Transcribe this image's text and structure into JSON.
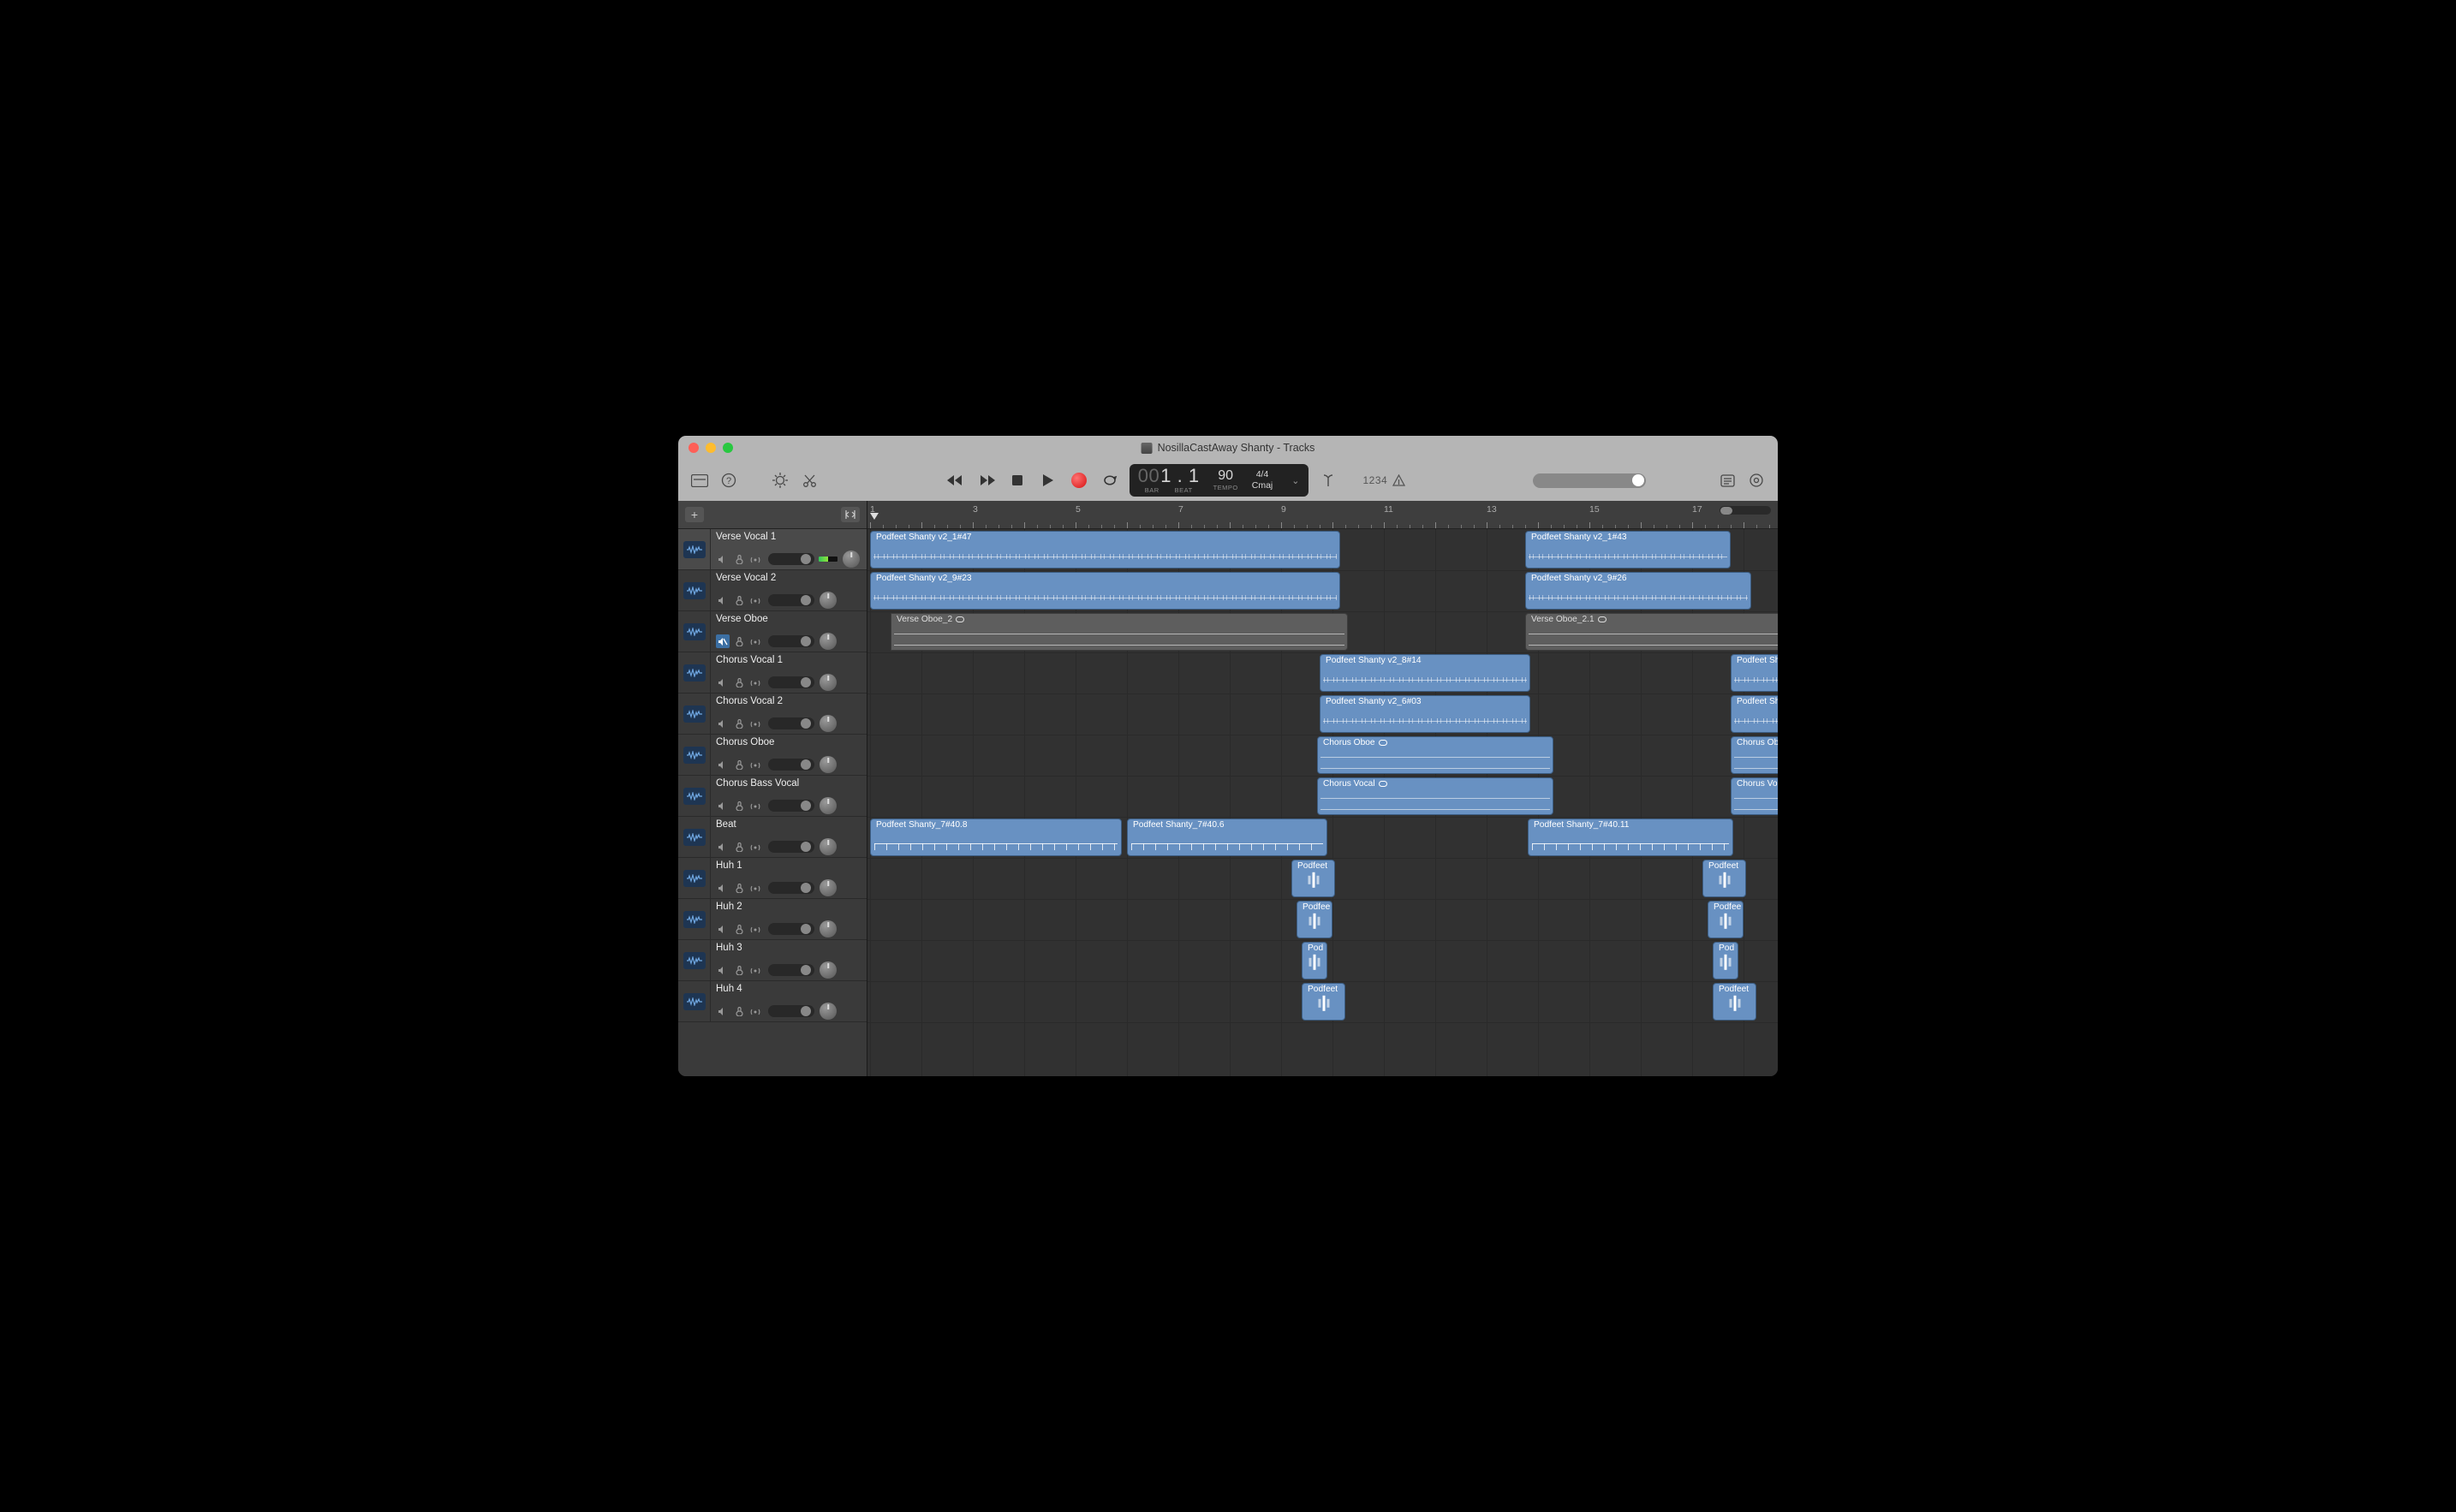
{
  "title": "NosillaCastAway Shanty - Tracks",
  "lcd": {
    "bar": "00",
    "beat": "1 . 1",
    "barLabel": "BAR",
    "beatLabel": "BEAT",
    "tempo": "90",
    "tempoLabel": "TEMPO",
    "sig": "4/4",
    "key": "Cmaj"
  },
  "countIn": "1234",
  "ruler": {
    "barWidth": 60,
    "startBar": 1,
    "numberedBars": [
      1,
      3,
      5,
      7,
      9,
      11,
      13,
      15,
      17
    ]
  },
  "tracks": [
    {
      "name": "Verse Vocal 1",
      "muted": false,
      "selected": true,
      "meter": 0.5,
      "volPos": 38
    },
    {
      "name": "Verse Vocal 2",
      "muted": false,
      "selected": false,
      "meter": 0,
      "volPos": 38
    },
    {
      "name": "Verse Oboe",
      "muted": true,
      "selected": false,
      "meter": 0,
      "volPos": 38
    },
    {
      "name": "Chorus Vocal 1",
      "muted": false,
      "selected": false,
      "meter": 0,
      "volPos": 38
    },
    {
      "name": "Chorus Vocal 2",
      "muted": false,
      "selected": false,
      "meter": 0,
      "volPos": 38
    },
    {
      "name": "Chorus Oboe",
      "muted": false,
      "selected": false,
      "meter": 0,
      "volPos": 38
    },
    {
      "name": "Chorus Bass Vocal",
      "muted": false,
      "selected": false,
      "meter": 0,
      "volPos": 38
    },
    {
      "name": "Beat",
      "muted": false,
      "selected": false,
      "meter": 0,
      "volPos": 38
    },
    {
      "name": "Huh 1",
      "muted": false,
      "selected": false,
      "meter": 0,
      "volPos": 38
    },
    {
      "name": "Huh 2",
      "muted": false,
      "selected": false,
      "meter": 0,
      "volPos": 38
    },
    {
      "name": "Huh 3",
      "muted": false,
      "selected": false,
      "meter": 0,
      "volPos": 38
    },
    {
      "name": "Huh 4",
      "muted": false,
      "selected": false,
      "meter": 0,
      "volPos": 38
    }
  ],
  "regions": [
    {
      "track": 0,
      "startBar": 1,
      "lenBars": 9.15,
      "label": "Podfeet Shanty v2_1#47",
      "style": "wave"
    },
    {
      "track": 0,
      "startBar": 13.75,
      "lenBars": 4.0,
      "label": "Podfeet Shanty v2_1#43",
      "style": "wave"
    },
    {
      "track": 1,
      "startBar": 1,
      "lenBars": 9.15,
      "label": "Podfeet Shanty v2_9#23",
      "style": "wave"
    },
    {
      "track": 1,
      "startBar": 13.75,
      "lenBars": 4.4,
      "label": "Podfeet Shanty v2_9#26",
      "style": "wave"
    },
    {
      "track": 2,
      "startBar": 1.4,
      "lenBars": 8.9,
      "label": "Verse Oboe_2",
      "loop": true,
      "style": "line",
      "grey": true,
      "leftInset": true
    },
    {
      "track": 2,
      "startBar": 13.75,
      "lenBars": 5.0,
      "label": "Verse Oboe_2.1",
      "loop": true,
      "style": "line",
      "grey": true
    },
    {
      "track": 3,
      "startBar": 9.75,
      "lenBars": 4.1,
      "label": "Podfeet Shanty v2_8#14",
      "style": "wave"
    },
    {
      "track": 3,
      "startBar": 17.75,
      "lenBars": 2.0,
      "label": "Podfeet Sh",
      "style": "wave"
    },
    {
      "track": 4,
      "startBar": 9.75,
      "lenBars": 4.1,
      "label": "Podfeet Shanty v2_6#03",
      "style": "wave"
    },
    {
      "track": 4,
      "startBar": 17.75,
      "lenBars": 2.0,
      "label": "Podfeet Sh",
      "style": "wave"
    },
    {
      "track": 5,
      "startBar": 9.7,
      "lenBars": 4.6,
      "label": "Chorus Oboe",
      "loop": true,
      "style": "line"
    },
    {
      "track": 5,
      "startBar": 17.75,
      "lenBars": 2.0,
      "label": "Chorus Ob",
      "style": "line"
    },
    {
      "track": 6,
      "startBar": 9.7,
      "lenBars": 4.6,
      "label": "Chorus Vocal",
      "loop": true,
      "style": "line"
    },
    {
      "track": 6,
      "startBar": 17.75,
      "lenBars": 2.0,
      "label": "Chorus Voc",
      "style": "line"
    },
    {
      "track": 7,
      "startBar": 1,
      "lenBars": 4.9,
      "label": "Podfeet Shanty_7#40.8",
      "style": "beat"
    },
    {
      "track": 7,
      "startBar": 6,
      "lenBars": 3.9,
      "label": "Podfeet Shanty_7#40.6",
      "style": "beat"
    },
    {
      "track": 7,
      "startBar": 13.8,
      "lenBars": 4.0,
      "label": "Podfeet Shanty_7#40.11",
      "style": "beat"
    },
    {
      "track": 8,
      "startBar": 9.2,
      "lenBars": 0.85,
      "label": "Podfeet",
      "style": "huh"
    },
    {
      "track": 8,
      "startBar": 17.2,
      "lenBars": 0.85,
      "label": "Podfeet",
      "style": "huh"
    },
    {
      "track": 9,
      "startBar": 9.3,
      "lenBars": 0.7,
      "label": "Podfee",
      "style": "huh"
    },
    {
      "track": 9,
      "startBar": 17.3,
      "lenBars": 0.7,
      "label": "Podfee",
      "style": "huh"
    },
    {
      "track": 10,
      "startBar": 9.4,
      "lenBars": 0.5,
      "label": "Pod",
      "style": "huh"
    },
    {
      "track": 10,
      "startBar": 17.4,
      "lenBars": 0.5,
      "label": "Pod",
      "style": "huh"
    },
    {
      "track": 11,
      "startBar": 9.4,
      "lenBars": 0.85,
      "label": "Podfeet",
      "style": "huh"
    },
    {
      "track": 11,
      "startBar": 17.4,
      "lenBars": 0.85,
      "label": "Podfeet",
      "style": "huh"
    }
  ]
}
